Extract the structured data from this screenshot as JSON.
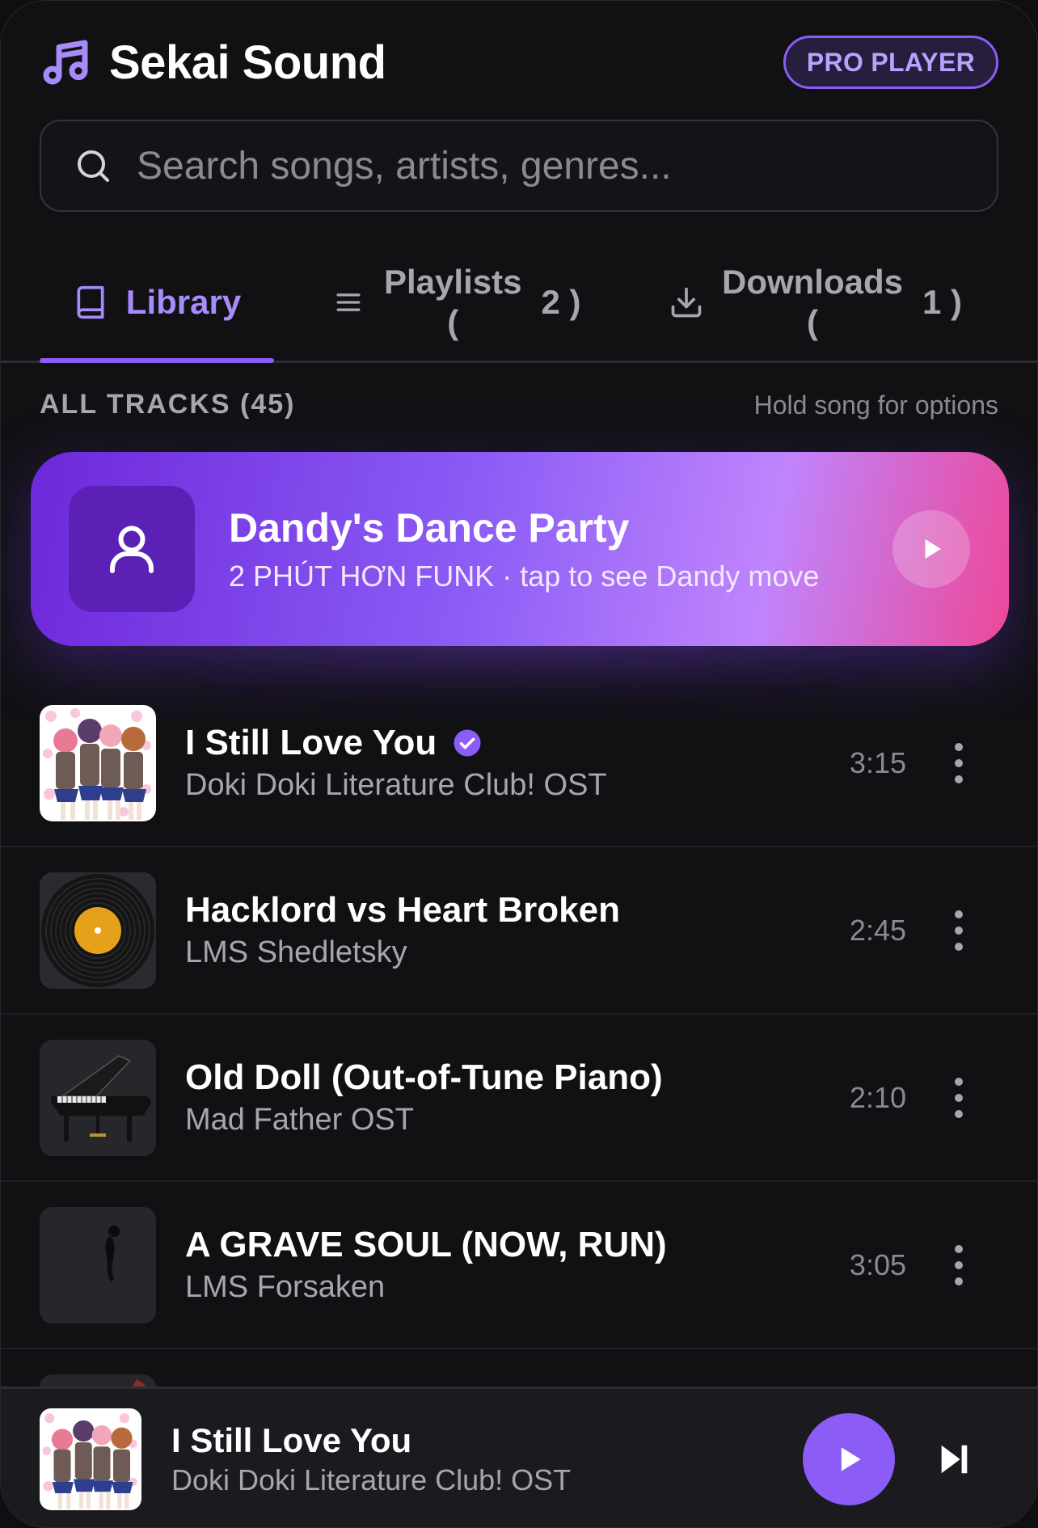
{
  "header": {
    "app_title": "Sekai Sound",
    "badge": "PRO PLAYER"
  },
  "search": {
    "placeholder": "Search songs, artists, genres..."
  },
  "tabs": [
    {
      "label": "Library",
      "active": true
    },
    {
      "label": "Playlists",
      "open": "(",
      "count": "2 )"
    },
    {
      "label": "Downloads",
      "open": "(",
      "count": "1 )"
    }
  ],
  "section": {
    "title": "ALL TRACKS (45)",
    "hint": "Hold song for options"
  },
  "featured": {
    "title": "Dandy's Dance Party",
    "subtitle": "2 PHÚT HƠN FUNK · tap to see Dandy move"
  },
  "tracks": [
    {
      "title": "I Still Love You",
      "artist": "Doki Doki Literature Club! OST",
      "duration": "3:15",
      "verified": true,
      "art": "anime-girls-art"
    },
    {
      "title": "Hacklord vs Heart Broken",
      "artist": "LMS Shedletsky",
      "duration": "2:45",
      "art": "vinyl-record-art"
    },
    {
      "title": "Old Doll (Out-of-Tune Piano)",
      "artist": "Mad Father OST",
      "duration": "2:10",
      "art": "grand-piano-art"
    },
    {
      "title": "A GRAVE SOUL (NOW, RUN)",
      "artist": "LMS Forsaken",
      "duration": "3:05",
      "art": "dark-figure-art"
    }
  ],
  "now_playing": {
    "title": "I Still Love You",
    "artist": "Doki Doki Literature Club! OST"
  },
  "colors": {
    "accent": "#8b5cf6",
    "accent_light": "#a78bfa",
    "background": "#111114",
    "featured_gradient_start": "#6d28d9",
    "featured_gradient_end": "#ec4899"
  }
}
